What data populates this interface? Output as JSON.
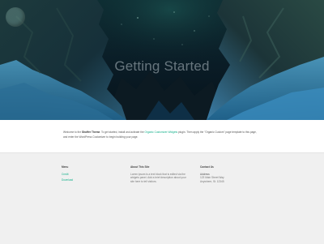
{
  "hero": {
    "title": "Getting Started"
  },
  "intro": {
    "p1": "Welcome to the ",
    "theme_name": "Shoffer Theme",
    "p2": ". To get started, install and activate the ",
    "plugin_link": "Organic Customizer Widgets",
    "p3": " plugin. Then apply the \"Organic Custom\" page template to this page, and enter the WordPress Customizer to begin building your page."
  },
  "footer": {
    "menu": {
      "heading": "Menu",
      "items": [
        "Credit",
        "Download"
      ]
    },
    "about": {
      "heading": "About This Site",
      "text": "Lorem ipsum is a text block that is edited via the widgets panel. Add a brief description about your site here to tell visitors."
    },
    "contact": {
      "heading": "Contact Us",
      "label": "Address",
      "line1": "123 Main Street Way",
      "line2": "Anywhere, St. 12345"
    }
  },
  "colors": {
    "accent": "#13b08a",
    "hero_bg": "#0b1d28",
    "footer_bg": "#f0f0f0"
  }
}
